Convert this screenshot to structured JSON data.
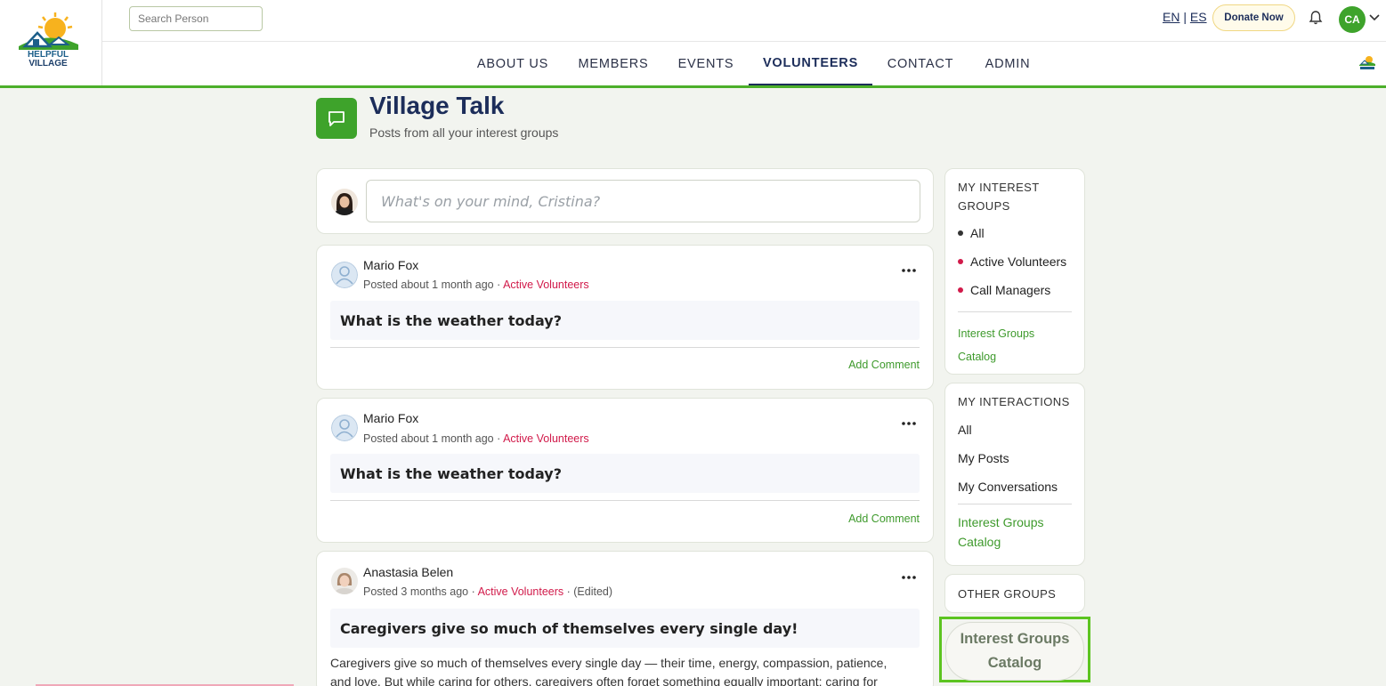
{
  "brand": {
    "logo_line1": "HELPFUL",
    "logo_line2": "VILLAGE"
  },
  "header": {
    "search_placeholder": "Search Person",
    "lang_en": "EN",
    "lang_sep": "|",
    "lang_es": "ES",
    "donate_label": "Donate Now",
    "avatar_initials": "CA"
  },
  "nav": {
    "items": [
      {
        "label": "ABOUT US"
      },
      {
        "label": "MEMBERS"
      },
      {
        "label": "EVENTS"
      },
      {
        "label": "VOLUNTEERS"
      },
      {
        "label": "CONTACT"
      },
      {
        "label": "ADMIN"
      }
    ],
    "active": "VOLUNTEERS"
  },
  "page": {
    "title": "Village Talk",
    "subtitle": "Posts from all your interest groups"
  },
  "composer": {
    "placeholder": "What's on your mind, Cristina?"
  },
  "posts": [
    {
      "author": "Mario Fox",
      "posted": "Posted about 1 month ago · ",
      "group": "Active Volunteers",
      "edited": "",
      "question": "What is the weather today?",
      "add_comment": "Add Comment"
    },
    {
      "author": "Mario Fox",
      "posted": "Posted about 1 month ago · ",
      "group": "Active Volunteers",
      "edited": "",
      "question": "What is the weather today?",
      "add_comment": "Add Comment"
    },
    {
      "author": "Anastasia Belen",
      "posted": "Posted 3 months ago · ",
      "group": "Active Volunteers",
      "edited": " · (Edited)",
      "question": "Caregivers give so much of themselves every single day!",
      "body": "Caregivers give so much of themselves every single day — their time, energy, compassion, patience, and love. But while caring for others, caregivers often forget something equally important: caring for"
    }
  ],
  "sidebar": {
    "my_groups": {
      "heading": "MY INTEREST GROUPS",
      "items": [
        {
          "label": "All",
          "dot_color": "#333333"
        },
        {
          "label": "Active Volunteers",
          "dot_color": "#d11a4a"
        },
        {
          "label": "Call Managers",
          "dot_color": "#d11a4a"
        }
      ],
      "catalog_link": "Interest Groups Catalog"
    },
    "my_interactions": {
      "heading": "MY INTERACTIONS",
      "items": [
        {
          "label": "All"
        },
        {
          "label": "My Posts"
        },
        {
          "label": "My Conversations"
        }
      ],
      "catalog_link": "Interest Groups Catalog"
    },
    "other_groups": {
      "heading": "OTHER GROUPS"
    },
    "catalog_button": "Interest Groups Catalog"
  },
  "colors": {
    "accent_green": "#3ea32b",
    "navy": "#1c2d5a",
    "group_red": "#d11a4a",
    "highlight": "#5cc420"
  }
}
